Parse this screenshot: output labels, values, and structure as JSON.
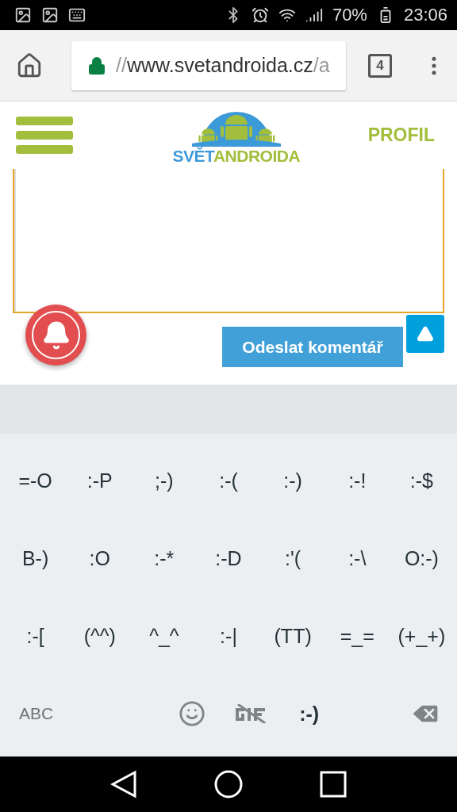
{
  "status_bar": {
    "battery": "70%",
    "time": "23:06"
  },
  "browser": {
    "url_scheme": "//",
    "url_host": "www.svetandroida.cz",
    "url_rest": "/a",
    "tab_count": "4"
  },
  "site_header": {
    "logo": {
      "part_1": "SVĚT",
      "part_2": "ANDROIDA"
    },
    "profile": "PROFIL"
  },
  "comment_form": {
    "submit_button": "Odeslat komentář"
  },
  "keyboard": {
    "rows": [
      [
        "=-O",
        ":-P",
        ";-)",
        ":-(",
        ":-)",
        ":-!",
        ":-$"
      ],
      [
        "B-)",
        ":O",
        ":-*",
        ":-D",
        ":'(",
        ":-\\",
        "O:-)"
      ],
      [
        ":-[",
        "(^^)",
        "^_^",
        ":-|",
        "(TT)",
        "=_=",
        "(+_+)"
      ]
    ],
    "modes": [
      {
        "kind": "text",
        "label": "ABC",
        "selected": false
      },
      {
        "kind": "emoji",
        "selected": false
      },
      {
        "kind": "gif",
        "selected": false
      },
      {
        "kind": "text",
        "label": ":-)",
        "selected": true
      }
    ]
  }
}
